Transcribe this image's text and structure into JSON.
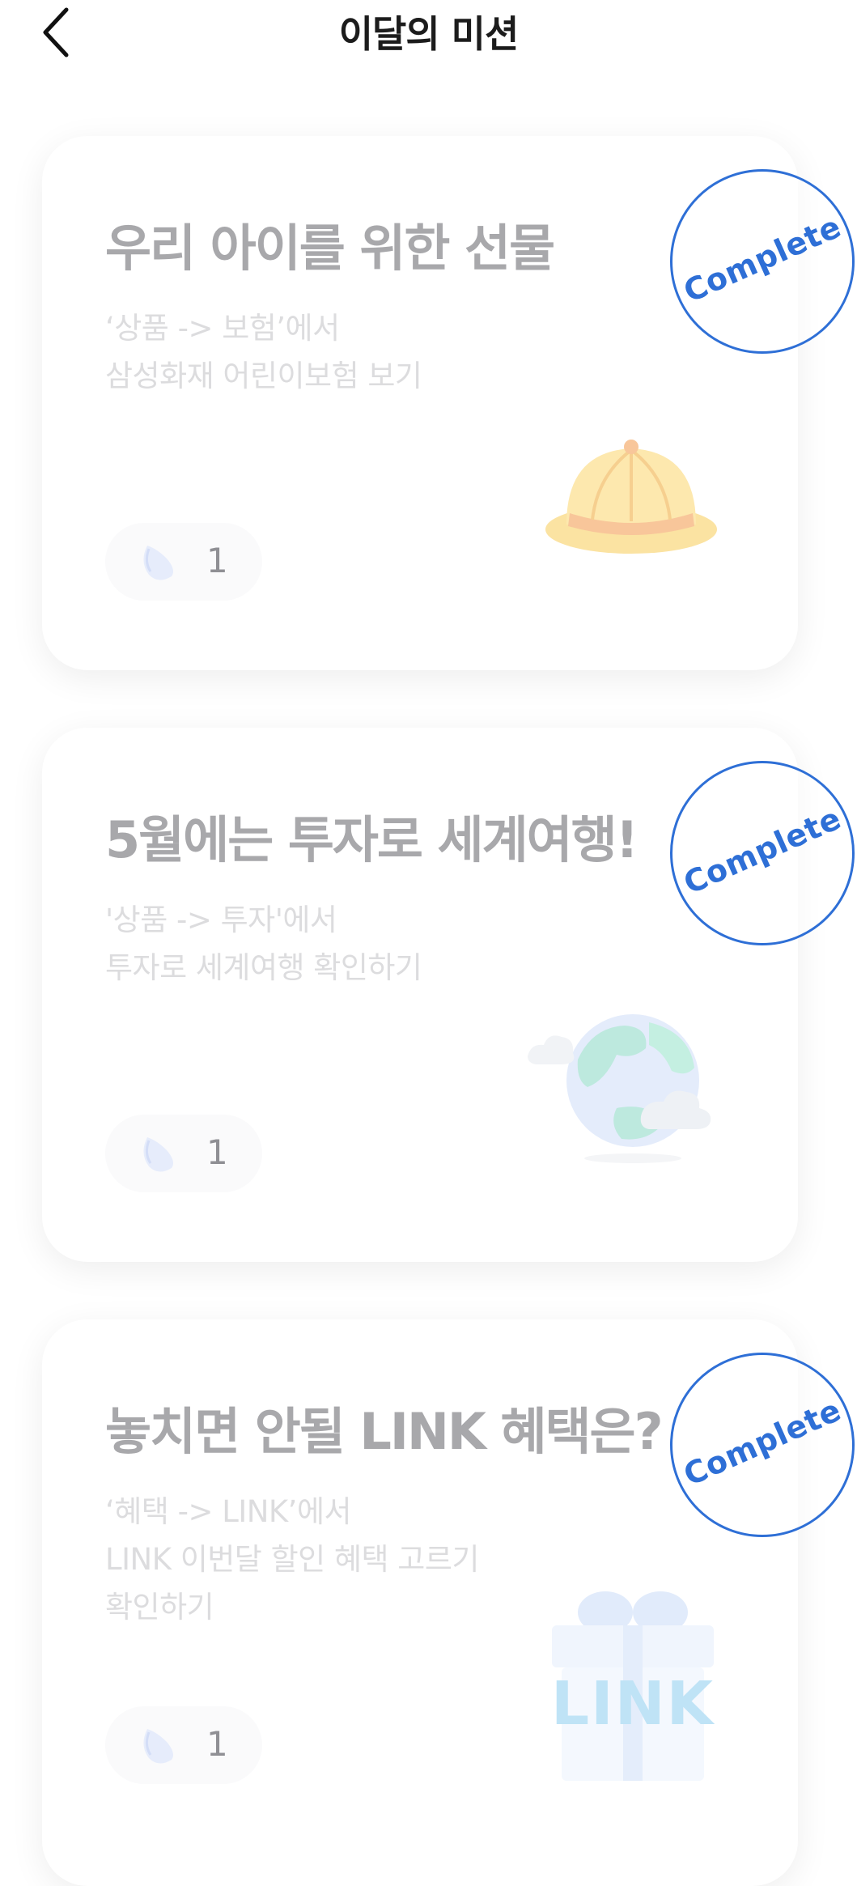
{
  "header": {
    "title": "이달의 미션",
    "back_icon": "chevron-left-icon"
  },
  "missions": [
    {
      "title": "우리 아이를 위한 선물",
      "desc_lines": [
        "‘상품 -> 보험’에서",
        "삼성화재 어린이보험 보기"
      ],
      "reward_count": "1",
      "reward_icon": "seed-icon",
      "status": "Complete",
      "illustration": "hat-icon"
    },
    {
      "title": "5월에는 투자로 세계여행!",
      "desc_lines": [
        "'상품 -> 투자'에서",
        "투자로 세계여행 확인하기"
      ],
      "reward_count": "1",
      "reward_icon": "seed-icon",
      "status": "Complete",
      "illustration": "globe-icon"
    },
    {
      "title": "놓치면 안될 LINK 혜택은?",
      "desc_lines": [
        "‘혜택 -> LINK’에서",
        "LINK 이번달 할인 혜택 고르기",
        "확인하기"
      ],
      "reward_count": "1",
      "reward_icon": "seed-icon",
      "status": "Complete",
      "illustration": "link-gift-icon",
      "illustration_text": "LINK"
    }
  ],
  "colors": {
    "complete_blue": "#2e6fd6",
    "title_gray": "#a8a8ab",
    "desc_gray": "#dcdcde"
  }
}
